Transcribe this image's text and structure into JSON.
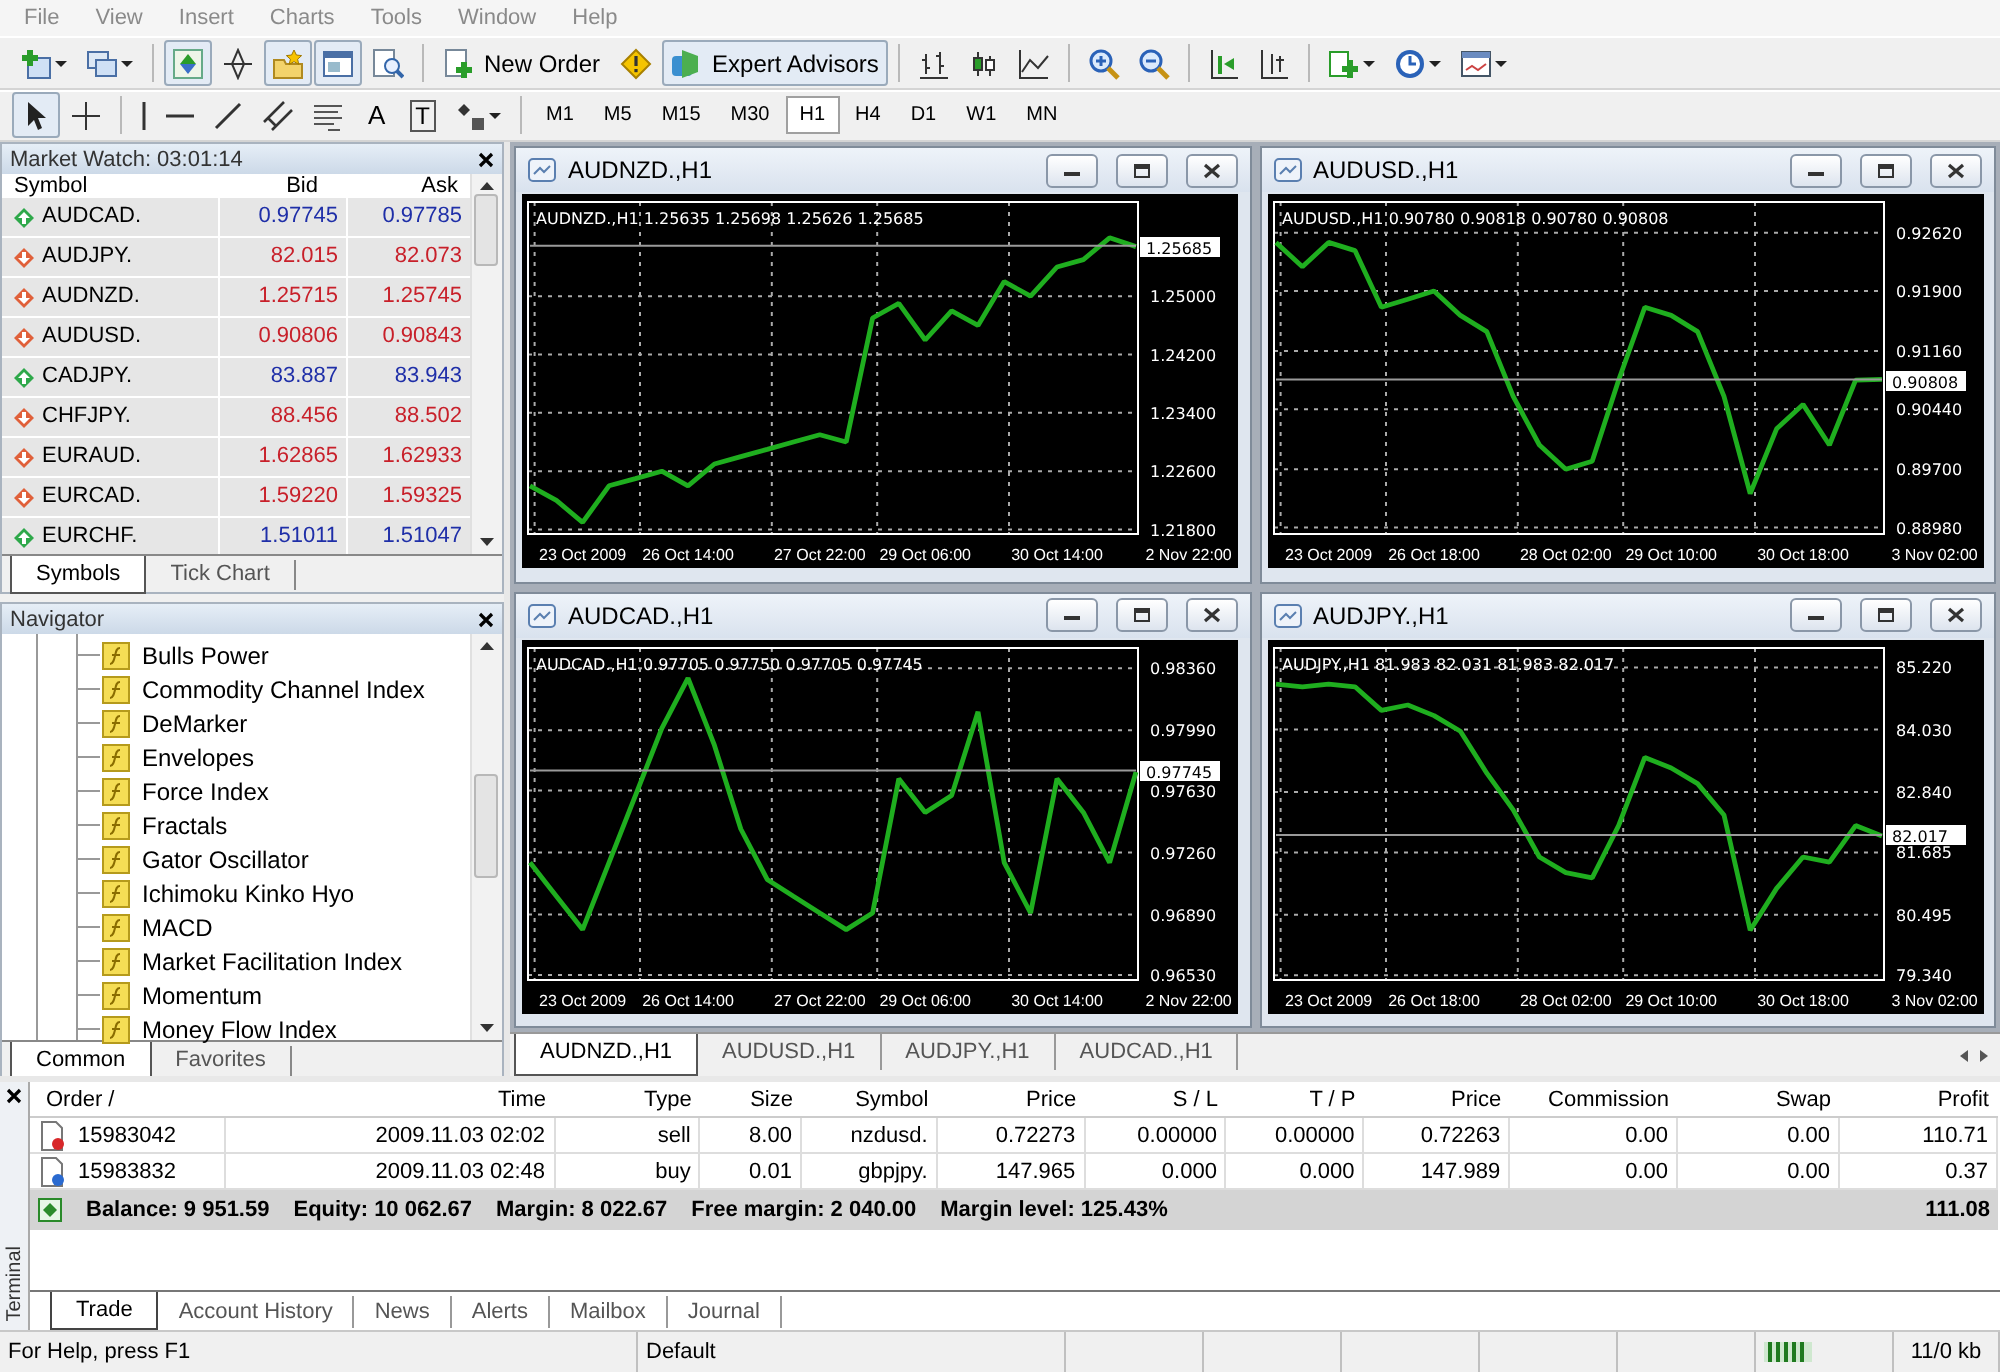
{
  "menu": [
    {
      "label": "File"
    },
    {
      "label": "View"
    },
    {
      "label": "Insert"
    },
    {
      "label": "Charts"
    },
    {
      "label": "Tools"
    },
    {
      "label": "Window"
    },
    {
      "label": "Help"
    }
  ],
  "toolbar": {
    "view_toggles": [
      {
        "pressed": true
      },
      {
        "pressed": false
      },
      {
        "pressed": true
      },
      {
        "pressed": true
      },
      {
        "pressed": false
      }
    ],
    "new_order": "New Order",
    "expert_advisors": {
      "label": "Expert Advisors",
      "pressed": true
    }
  },
  "drawing_toolbar": {
    "tools": [
      {
        "selected": true
      },
      {
        "selected": false
      }
    ],
    "text_tool": "A",
    "label_tool": "T",
    "timeframes": [
      {
        "label": "M1",
        "selected": false
      },
      {
        "label": "M5",
        "selected": false
      },
      {
        "label": "M15",
        "selected": false
      },
      {
        "label": "M30",
        "selected": false
      },
      {
        "label": "H1",
        "selected": true
      },
      {
        "label": "H4",
        "selected": false
      },
      {
        "label": "D1",
        "selected": false
      },
      {
        "label": "W1",
        "selected": false
      },
      {
        "label": "MN",
        "selected": false
      }
    ]
  },
  "market_watch": {
    "title": "Market Watch: 03:01:14",
    "columns": [
      "Symbol",
      "Bid",
      "Ask"
    ],
    "rows": [
      {
        "symbol": "AUDCAD.",
        "bid": "0.97745",
        "ask": "0.97785",
        "kind": "up"
      },
      {
        "symbol": "AUDJPY.",
        "bid": "82.015",
        "ask": "82.073",
        "kind": "down"
      },
      {
        "symbol": "AUDNZD.",
        "bid": "1.25715",
        "ask": "1.25745",
        "kind": "down"
      },
      {
        "symbol": "AUDUSD.",
        "bid": "0.90806",
        "ask": "0.90843",
        "kind": "down"
      },
      {
        "symbol": "CADJPY.",
        "bid": "83.887",
        "ask": "83.943",
        "kind": "up"
      },
      {
        "symbol": "CHFJPY.",
        "bid": "88.456",
        "ask": "88.502",
        "kind": "down"
      },
      {
        "symbol": "EURAUD.",
        "bid": "1.62865",
        "ask": "1.62933",
        "kind": "down"
      },
      {
        "symbol": "EURCAD.",
        "bid": "1.59220",
        "ask": "1.59325",
        "kind": "down"
      },
      {
        "symbol": "EURCHF.",
        "bid": "1.51011",
        "ask": "1.51047",
        "kind": "up"
      }
    ],
    "tabs": [
      {
        "label": "Symbols",
        "selected": true
      },
      {
        "label": "Tick Chart",
        "selected": false
      }
    ]
  },
  "navigator": {
    "title": "Navigator",
    "items": [
      {
        "label": "Bulls Power"
      },
      {
        "label": "Commodity Channel Index"
      },
      {
        "label": "DeMarker"
      },
      {
        "label": "Envelopes"
      },
      {
        "label": "Force Index"
      },
      {
        "label": "Fractals"
      },
      {
        "label": "Gator Oscillator"
      },
      {
        "label": "Ichimoku Kinko Hyo"
      },
      {
        "label": "MACD"
      },
      {
        "label": "Market Facilitation Index"
      },
      {
        "label": "Momentum"
      },
      {
        "label": "Money Flow Index"
      }
    ],
    "tabs": [
      {
        "label": "Common",
        "selected": true
      },
      {
        "label": "Favorites",
        "selected": false
      }
    ]
  },
  "charts": [
    {
      "title": "AUDNZD.,H1",
      "chart_data": {
        "type": "line",
        "title": "AUDNZD.,H1  1.25635 1.25698 1.25626 1.25685",
        "grid": true,
        "ylim": [
          1.2174,
          1.2629
        ],
        "yticks": [
          {
            "value": 1.25,
            "label": "1.25000"
          },
          {
            "value": 1.242,
            "label": "1.24200"
          },
          {
            "value": 1.234,
            "label": "1.23400"
          },
          {
            "value": 1.226,
            "label": "1.22600"
          },
          {
            "value": 1.218,
            "label": "1.21800"
          }
        ],
        "categories": [
          null,
          null,
          "23 Oct 2009",
          null,
          null,
          null,
          "26 Oct 14:00",
          null,
          null,
          null,
          null,
          "27 Oct 22:00",
          null,
          null,
          null,
          "29 Oct 06:00",
          null,
          null,
          null,
          null,
          "30 Oct 14:00",
          null,
          null,
          null,
          null,
          "2 Nov 22:00"
        ],
        "series": [
          {
            "color": "#1fae1f",
            "values": [
              1.224,
              1.222,
              1.219,
              1.224,
              1.225,
              1.226,
              1.224,
              1.227,
              1.228,
              1.229,
              1.23,
              1.231,
              1.23,
              1.247,
              1.249,
              1.244,
              1.248,
              1.246,
              1.252,
              1.25,
              1.254,
              1.255,
              1.258,
              1.2568,
              null,
              null
            ]
          },
          {
            "name": "1.25685",
            "color": "#9a9a9a",
            "values": [
              1.2569,
              1.2569,
              1.2569,
              1.2569,
              1.2569,
              1.2569,
              1.2569,
              1.2569,
              1.2569,
              1.2569,
              1.2569,
              1.2569,
              1.2569,
              1.2569,
              1.2569,
              1.2569,
              1.2569,
              1.2569,
              1.2569,
              1.2569,
              1.2569,
              1.2569,
              1.2569,
              1.2569,
              null,
              null
            ]
          }
        ]
      }
    },
    {
      "title": "AUDUSD.,H1",
      "chart_data": {
        "type": "line",
        "title": "AUDUSD.,H1  0.90780 0.90818 0.90780 0.90808",
        "grid": true,
        "ylim": [
          0.889,
          0.93
        ],
        "yticks": [
          {
            "value": 0.9262,
            "label": "0.92620"
          },
          {
            "value": 0.919,
            "label": "0.91900"
          },
          {
            "value": 0.9116,
            "label": "0.91160"
          },
          {
            "value": 0.9044,
            "label": "0.90440"
          },
          {
            "value": 0.897,
            "label": "0.89700"
          },
          {
            "value": 0.8898,
            "label": "0.88980"
          }
        ],
        "categories": [
          null,
          null,
          "23 Oct 2009",
          null,
          null,
          null,
          "26 Oct 18:00",
          null,
          null,
          null,
          null,
          "28 Oct 02:00",
          null,
          null,
          null,
          "29 Oct 10:00",
          null,
          null,
          null,
          null,
          "30 Oct 18:00",
          null,
          null,
          null,
          null,
          "3 Nov 02:00"
        ],
        "series": [
          {
            "color": "#1fae1f",
            "values": [
              0.925,
              0.922,
              0.925,
              0.924,
              0.917,
              0.918,
              0.919,
              0.916,
              0.914,
              0.906,
              0.9,
              0.897,
              0.898,
              0.908,
              0.917,
              0.916,
              0.914,
              0.906,
              0.894,
              0.902,
              0.905,
              0.9,
              0.908,
              0.9081,
              null,
              null
            ]
          },
          {
            "name": "0.90808",
            "color": "#9a9a9a",
            "values": [
              0.9081,
              0.9081,
              0.9081,
              0.9081,
              0.9081,
              0.9081,
              0.9081,
              0.9081,
              0.9081,
              0.9081,
              0.9081,
              0.9081,
              0.9081,
              0.9081,
              0.9081,
              0.9081,
              0.9081,
              0.9081,
              0.9081,
              0.9081,
              0.9081,
              0.9081,
              0.9081,
              0.9081,
              null,
              null
            ]
          }
        ]
      }
    },
    {
      "title": "AUDCAD.,H1",
      "chart_data": {
        "type": "line",
        "title": "AUDCAD.,H1  0.97705 0.97750 0.97705 0.97745",
        "grid": true,
        "ylim": [
          0.965,
          0.9848
        ],
        "yticks": [
          {
            "value": 0.9836,
            "label": "0.98360"
          },
          {
            "value": 0.9799,
            "label": "0.97990"
          },
          {
            "value": 0.9763,
            "label": "0.97630"
          },
          {
            "value": 0.9726,
            "label": "0.97260"
          },
          {
            "value": 0.9689,
            "label": "0.96890"
          },
          {
            "value": 0.9653,
            "label": "0.96530"
          }
        ],
        "categories": [
          null,
          null,
          "23 Oct 2009",
          null,
          null,
          null,
          "26 Oct 14:00",
          null,
          null,
          null,
          null,
          "27 Oct 22:00",
          null,
          null,
          null,
          "29 Oct 06:00",
          null,
          null,
          null,
          null,
          "30 Oct 14:00",
          null,
          null,
          null,
          null,
          "2 Nov 22:00"
        ],
        "series": [
          {
            "color": "#1fae1f",
            "values": [
              0.972,
              0.97,
              0.968,
              0.972,
              0.976,
              0.98,
              0.983,
              0.979,
              0.974,
              0.971,
              0.97,
              0.969,
              0.968,
              0.969,
              0.977,
              0.975,
              0.976,
              0.981,
              0.972,
              0.969,
              0.977,
              0.975,
              0.972,
              0.9774,
              null,
              null
            ]
          },
          {
            "name": "0.97745",
            "color": "#9a9a9a",
            "values": [
              0.9775,
              0.9775,
              0.9775,
              0.9775,
              0.9775,
              0.9775,
              0.9775,
              0.9775,
              0.9775,
              0.9775,
              0.9775,
              0.9775,
              0.9775,
              0.9775,
              0.9775,
              0.9775,
              0.9775,
              0.9775,
              0.9775,
              0.9775,
              0.9775,
              0.9775,
              0.9775,
              0.9775,
              null,
              null
            ]
          }
        ]
      }
    },
    {
      "title": "AUDJPY.,H1",
      "chart_data": {
        "type": "line",
        "title": "AUDJPY.,H1  81.983 82.031 81.983 82.017",
        "grid": true,
        "ylim": [
          79.25,
          85.59
        ],
        "yticks": [
          {
            "value": 85.22,
            "label": "85.220"
          },
          {
            "value": 84.03,
            "label": "84.030"
          },
          {
            "value": 82.84,
            "label": "82.840"
          },
          {
            "value": 81.685,
            "label": "81.685"
          },
          {
            "value": 80.495,
            "label": "80.495"
          },
          {
            "value": 79.34,
            "label": "79.340"
          }
        ],
        "categories": [
          null,
          null,
          "23 Oct 2009",
          null,
          null,
          null,
          "26 Oct 18:00",
          null,
          null,
          null,
          null,
          "28 Oct 02:00",
          null,
          null,
          null,
          "29 Oct 10:00",
          null,
          null,
          null,
          null,
          "30 Oct 18:00",
          null,
          null,
          null,
          null,
          "3 Nov 02:00"
        ],
        "series": [
          {
            "color": "#1fae1f",
            "values": [
              84.9,
              84.85,
              84.9,
              84.85,
              84.4,
              84.5,
              84.3,
              84.0,
              83.2,
              82.5,
              81.6,
              81.3,
              81.2,
              82.2,
              83.5,
              83.3,
              83.0,
              82.4,
              80.2,
              81.0,
              81.6,
              81.5,
              82.2,
              82.0,
              null,
              null
            ]
          },
          {
            "name": "82.017",
            "color": "#9a9a9a",
            "values": [
              82.02,
              82.02,
              82.02,
              82.02,
              82.02,
              82.02,
              82.02,
              82.02,
              82.02,
              82.02,
              82.02,
              82.02,
              82.02,
              82.02,
              82.02,
              82.02,
              82.02,
              82.02,
              82.02,
              82.02,
              82.02,
              82.02,
              82.02,
              82.02,
              null,
              null
            ]
          }
        ]
      }
    }
  ],
  "chart_tabs": [
    {
      "label": "AUDNZD.,H1",
      "selected": true
    },
    {
      "label": "AUDUSD.,H1",
      "selected": false
    },
    {
      "label": "AUDJPY.,H1",
      "selected": false
    },
    {
      "label": "AUDCAD.,H1",
      "selected": false
    }
  ],
  "terminal": {
    "title": "Terminal",
    "columns": [
      "Order  /",
      "Time",
      "Type",
      "Size",
      "Symbol",
      "Price",
      "S / L",
      "T / P",
      "Price",
      "Commission",
      "Swap",
      "Profit"
    ],
    "rows": [
      {
        "kind": "sell",
        "cells": [
          "15983042",
          "2009.11.03 02:02",
          "sell",
          "8.00",
          "nzdusd.",
          "0.72273",
          "0.00000",
          "0.00000",
          "0.72263",
          "0.00",
          "0.00",
          "110.71"
        ]
      },
      {
        "kind": "buy",
        "cells": [
          "15983832",
          "2009.11.03 02:48",
          "buy",
          "0.01",
          "gbpjpy.",
          "147.965",
          "0.000",
          "0.000",
          "147.989",
          "0.00",
          "0.00",
          "0.37"
        ]
      }
    ],
    "summary": {
      "items": [
        "Balance: 9 951.59",
        "Equity: 10 062.67",
        "Margin: 8 022.67",
        "Free margin: 2 040.00",
        "Margin level: 125.43%"
      ],
      "total": "111.08"
    },
    "tabs": [
      {
        "label": "Trade",
        "selected": true
      },
      {
        "label": "Account History",
        "selected": false
      },
      {
        "label": "News",
        "selected": false
      },
      {
        "label": "Alerts",
        "selected": false
      },
      {
        "label": "Mailbox",
        "selected": false
      },
      {
        "label": "Journal",
        "selected": false
      }
    ]
  },
  "status_bar": {
    "help": "For Help, press F1",
    "profile": "Default",
    "traffic": "11/0 kb"
  }
}
